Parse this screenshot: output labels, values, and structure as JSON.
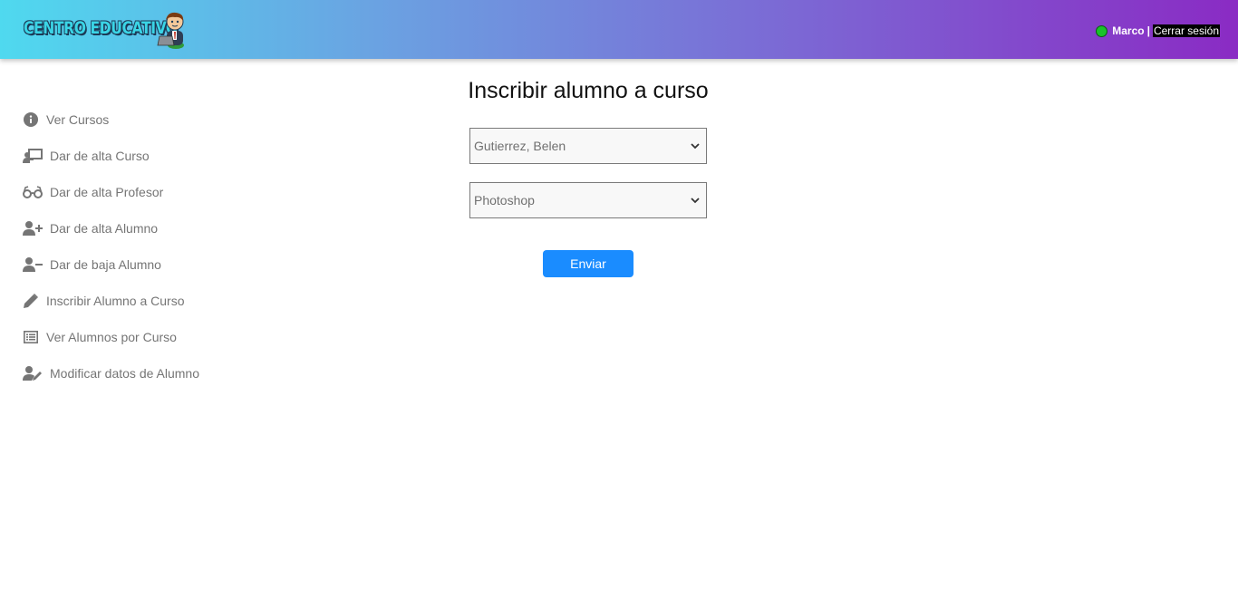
{
  "header": {
    "logo_text": "CENTRO EDUCATIVO",
    "user_name": "Marco",
    "separator": "|",
    "logout_label": "Cerrar sesión",
    "status_color": "#19c22a"
  },
  "sidebar": {
    "items": [
      {
        "label": "Ver Cursos",
        "icon": "info-circle-icon"
      },
      {
        "label": "Dar de alta Curso",
        "icon": "chalkboard-teacher-icon"
      },
      {
        "label": "Dar de alta Profesor",
        "icon": "glasses-icon"
      },
      {
        "label": "Dar de alta Alumno",
        "icon": "user-plus-icon"
      },
      {
        "label": "Dar de baja Alumno",
        "icon": "user-minus-icon"
      },
      {
        "label": "Inscribir Alumno a Curso",
        "icon": "pencil-icon"
      },
      {
        "label": "Ver Alumnos por Curso",
        "icon": "list-icon"
      },
      {
        "label": "Modificar datos de Alumno",
        "icon": "user-edit-icon"
      }
    ]
  },
  "main": {
    "title": "Inscribir alumno a curso",
    "student_select_value": "Gutierrez, Belen",
    "course_select_value": "Photoshop",
    "submit_label": "Enviar"
  },
  "colors": {
    "accent": "#1a8cff",
    "nav_text": "#757575"
  }
}
